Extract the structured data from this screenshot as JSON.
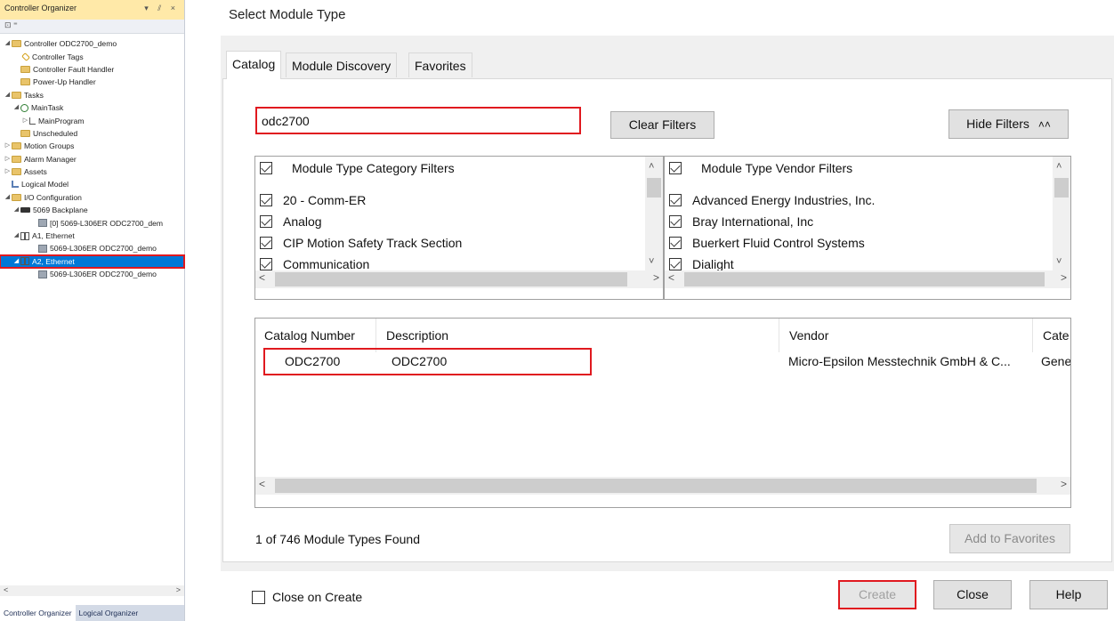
{
  "left_pane": {
    "title": "Controller Organizer",
    "title_controls": "▾ ⫽ ×",
    "toolbar_icons": "⊡ ⁼",
    "tree": [
      {
        "label": "Controller ODC2700_demo",
        "indent": 0,
        "arrow": "◢",
        "icon": "folder"
      },
      {
        "label": "Controller Tags",
        "indent": 1,
        "arrow": "",
        "icon": "tag"
      },
      {
        "label": "Controller Fault Handler",
        "indent": 1,
        "arrow": "",
        "icon": "folder"
      },
      {
        "label": "Power-Up Handler",
        "indent": 1,
        "arrow": "",
        "icon": "folder"
      },
      {
        "label": "Tasks",
        "indent": 0,
        "arrow": "◢",
        "icon": "folder"
      },
      {
        "label": "MainTask",
        "indent": 1,
        "arrow": "◢",
        "icon": "task"
      },
      {
        "label": "MainProgram",
        "indent": 2,
        "arrow": "▷",
        "icon": "prog"
      },
      {
        "label": "Unscheduled",
        "indent": 1,
        "arrow": "",
        "icon": "folder"
      },
      {
        "label": "Motion Groups",
        "indent": 0,
        "arrow": "▷",
        "icon": "folder"
      },
      {
        "label": "Alarm Manager",
        "indent": 0,
        "arrow": "▷",
        "icon": "folder"
      },
      {
        "label": "Assets",
        "indent": 0,
        "arrow": "▷",
        "icon": "folder"
      },
      {
        "label": "Logical Model",
        "indent": 0,
        "arrow": "",
        "icon": "lm"
      },
      {
        "label": "I/O Configuration",
        "indent": 0,
        "arrow": "◢",
        "icon": "folder"
      },
      {
        "label": "5069 Backplane",
        "indent": 1,
        "arrow": "◢",
        "icon": "rack"
      },
      {
        "label": "[0] 5069-L306ER ODC2700_dem",
        "indent": 3,
        "arrow": "",
        "icon": "mod"
      },
      {
        "label": "A1, Ethernet",
        "indent": 1,
        "arrow": "◢",
        "icon": "net"
      },
      {
        "label": "5069-L306ER ODC2700_demo",
        "indent": 3,
        "arrow": "",
        "icon": "mod"
      },
      {
        "label": "A2, Ethernet",
        "indent": 1,
        "arrow": "◢",
        "icon": "net",
        "selected": true
      },
      {
        "label": "5069-L306ER ODC2700_demo",
        "indent": 3,
        "arrow": "",
        "icon": "mod"
      }
    ],
    "bottom_tabs": [
      "Controller Organizer",
      "Logical Organizer"
    ]
  },
  "dialog": {
    "title": "Select Module Type",
    "tabs": [
      "Catalog",
      "Module Discovery",
      "Favorites"
    ],
    "search": {
      "value": "odc2700"
    },
    "clear_filters": "Clear Filters",
    "hide_filters": "Hide Filters",
    "hide_filters_chevron": "≈",
    "category_filters": {
      "header": "Module Type Category Filters",
      "items": [
        "20 - Comm-ER",
        "Analog",
        "CIP Motion Safety Track Section",
        "Communication"
      ]
    },
    "vendor_filters": {
      "header": "Module Type Vendor Filters",
      "items": [
        "Advanced Energy Industries, Inc.",
        "Bray International, Inc",
        "Buerkert Fluid Control Systems",
        "Dialight"
      ]
    },
    "results": {
      "columns": [
        "Catalog Number",
        "Description",
        "Vendor",
        "Cate"
      ],
      "rows": [
        {
          "catalog": "ODC2700",
          "description": "ODC2700",
          "vendor": "Micro-Epsilon Messtechnik GmbH & C...",
          "category": "Gene"
        }
      ]
    },
    "count_label": "1 of 746 Module Types Found",
    "add_to_favorites": "Add to Favorites",
    "close_on_create": "Close on Create",
    "buttons": {
      "create": "Create",
      "close": "Close",
      "help": "Help"
    }
  },
  "colors": {
    "accent_red": "#e0191f",
    "selection_blue": "#0078d7",
    "title_bar": "#ffe9a8"
  }
}
